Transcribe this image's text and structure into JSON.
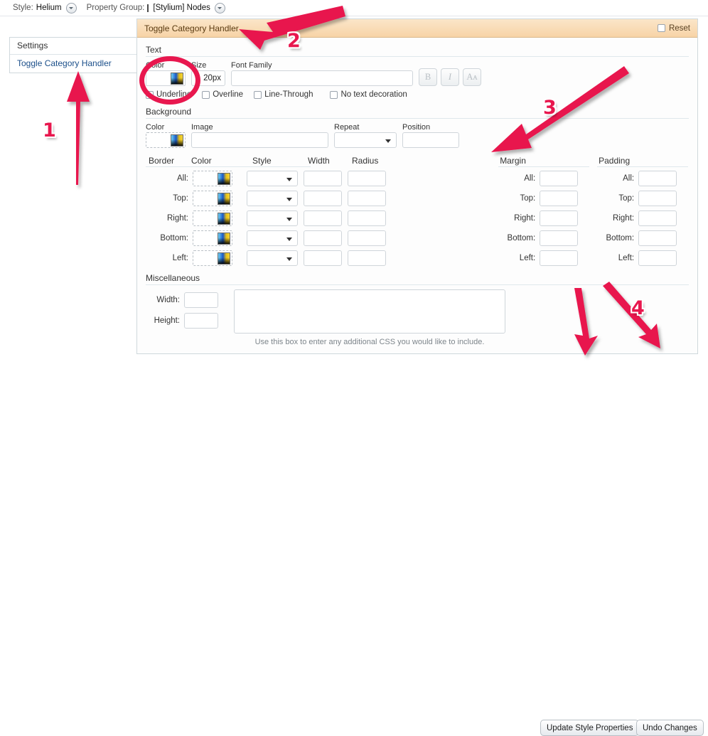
{
  "toolbar": {
    "style_label": "Style:",
    "style_value": "Helium",
    "group_label": "Property Group:",
    "group_value": "[Stylium] Nodes"
  },
  "sidebar": {
    "header": "Settings",
    "link": "Toggle Category Handler"
  },
  "panel": {
    "title": "Toggle Category Handler",
    "reset_label": "Reset"
  },
  "text_section": {
    "title": "Text",
    "color_label": "Color",
    "size_label": "Size",
    "size_value": "20px",
    "font_family_label": "Font Family",
    "font_family_value": "",
    "bold_label": "B",
    "italic_label": "I",
    "transform_label": "Aᴀ",
    "checks": [
      {
        "label": "Underline",
        "checked": false
      },
      {
        "label": "Overline",
        "checked": false
      },
      {
        "label": "Line-Through",
        "checked": false
      },
      {
        "label": "No text decoration",
        "checked": false
      }
    ]
  },
  "background_section": {
    "title": "Background",
    "color_label": "Color",
    "image_label": "Image",
    "image_value": "",
    "repeat_label": "Repeat",
    "repeat_value": "",
    "position_label": "Position",
    "position_value": ""
  },
  "box_section": {
    "border_title": "Border",
    "col_color": "Color",
    "col_style": "Style",
    "col_width": "Width",
    "col_radius": "Radius",
    "margin_title": "Margin",
    "padding_title": "Padding",
    "rows": [
      "All:",
      "Top:",
      "Right:",
      "Bottom:",
      "Left:"
    ]
  },
  "misc_section": {
    "title": "Miscellaneous",
    "width_label": "Width:",
    "width_value": "",
    "height_label": "Height:",
    "height_value": "",
    "css_value": "",
    "hint": "Use this box to enter any additional CSS you would like to include."
  },
  "buttons": {
    "update": "Update Style Properties",
    "undo": "Undo Changes"
  },
  "annotations": {
    "one": "1",
    "two": "2",
    "three": "3",
    "four": "4",
    "accent": "#e8174e"
  }
}
